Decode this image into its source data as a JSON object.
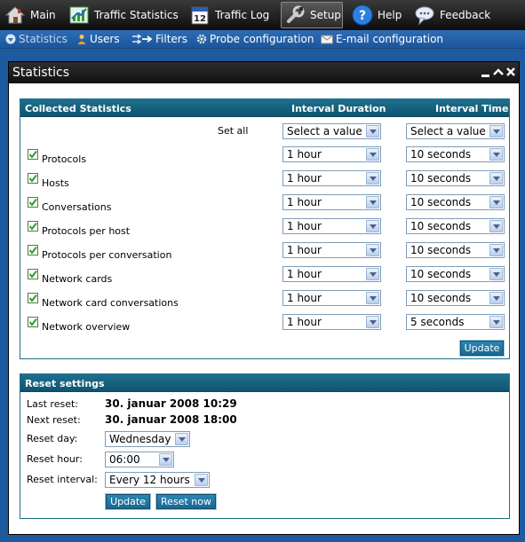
{
  "topnav": [
    {
      "label": "Main",
      "icon": "house-icon"
    },
    {
      "label": "Traffic Statistics",
      "icon": "chart-icon"
    },
    {
      "label": "Traffic Log",
      "icon": "calendar-icon",
      "icon_text": "12"
    },
    {
      "label": "Setup",
      "icon": "wrench-icon",
      "active": true
    },
    {
      "label": "Help",
      "icon": "help-icon",
      "icon_text": "?"
    },
    {
      "label": "Feedback",
      "icon": "speech-bubble-icon"
    }
  ],
  "subnav": [
    {
      "label": "Statistics",
      "icon": "chart-small-icon",
      "active": true
    },
    {
      "label": "Users",
      "icon": "user-icon"
    },
    {
      "label": "Filters",
      "icon": "filter-arrows-icon"
    },
    {
      "label": "Probe configuration",
      "icon": "gear-icon"
    },
    {
      "label": "E-mail configuration",
      "icon": "envelope-icon"
    }
  ],
  "window": {
    "title": "Statistics"
  },
  "collected": {
    "header": "Collected Statistics",
    "col_interval_duration": "Interval Duration",
    "col_interval_time": "Interval Time",
    "set_all_label": "Set all",
    "set_all_duration": "Select a value",
    "set_all_time": "Select a value",
    "rows": [
      {
        "label": "Protocols",
        "checked": true,
        "duration": "1 hour",
        "time": "10 seconds"
      },
      {
        "label": "Hosts",
        "checked": true,
        "duration": "1 hour",
        "time": "10 seconds"
      },
      {
        "label": "Conversations",
        "checked": true,
        "duration": "1 hour",
        "time": "10 seconds"
      },
      {
        "label": "Protocols per host",
        "checked": true,
        "duration": "1 hour",
        "time": "10 seconds"
      },
      {
        "label": "Protocols per conversation",
        "checked": true,
        "duration": "1 hour",
        "time": "10 seconds"
      },
      {
        "label": "Network cards",
        "checked": true,
        "duration": "1 hour",
        "time": "10 seconds"
      },
      {
        "label": "Network card conversations",
        "checked": true,
        "duration": "1 hour",
        "time": "10 seconds"
      },
      {
        "label": "Network overview",
        "checked": true,
        "duration": "1 hour",
        "time": "5 seconds"
      }
    ],
    "update_label": "Update"
  },
  "reset": {
    "header": "Reset settings",
    "last_reset_label": "Last reset:",
    "last_reset_value": "30. januar 2008 10:29",
    "next_reset_label": "Next reset:",
    "next_reset_value": "30. januar 2008 18:00",
    "reset_day_label": "Reset day:",
    "reset_day_value": "Wednesday",
    "reset_hour_label": "Reset hour:",
    "reset_hour_value": "06:00",
    "reset_interval_label": "Reset interval:",
    "reset_interval_value": "Every 12 hours",
    "update_label": "Update",
    "reset_now_label": "Reset now"
  },
  "colors": {
    "accent": "#1f6f8e",
    "background": "#1e5a9e",
    "toolbar": "#111111",
    "checkbox": "#2e9b2e"
  }
}
